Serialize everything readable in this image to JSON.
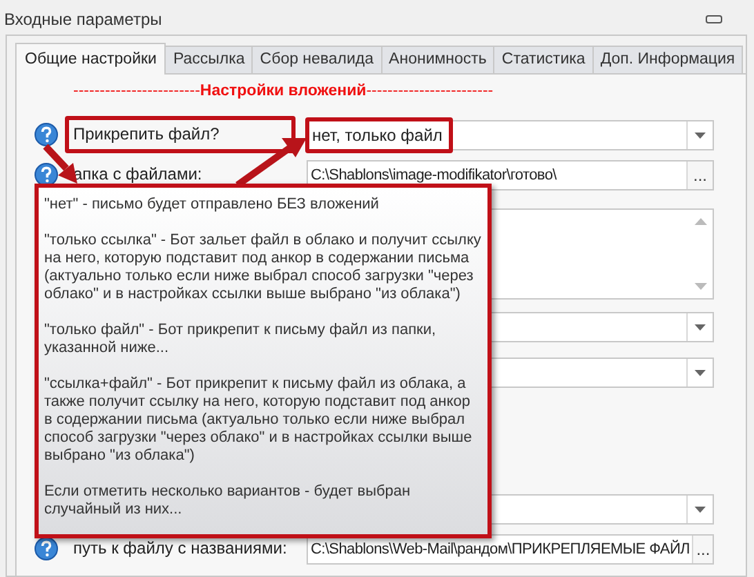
{
  "panel": {
    "title": "Входные параметры"
  },
  "tabs": [
    {
      "label": "Общие настройки",
      "selected": true
    },
    {
      "label": "Рассылка",
      "selected": false
    },
    {
      "label": "Сбор невалида",
      "selected": false
    },
    {
      "label": "Анонимность",
      "selected": false
    },
    {
      "label": "Статистика",
      "selected": false
    },
    {
      "label": "Доп. Информация",
      "selected": false
    }
  ],
  "section_heading": "------------------------**Настройки вложений**------------------------",
  "fields": [
    {
      "kind": "combo",
      "help": true,
      "label": "Прикрепить файл?",
      "value": "нет, только файл",
      "highlighted": true
    },
    {
      "kind": "path",
      "help": true,
      "label": "апка с файлами:",
      "value": "C:\\Shablons\\image-modifikator\\готово\\",
      "button": "..."
    },
    {
      "kind": "textarea"
    },
    {
      "kind": "combo"
    },
    {
      "kind": "combo"
    },
    {
      "kind": "combo"
    },
    {
      "kind": "path",
      "help": true,
      "label": "путь к файлу с названиями:",
      "value": "C:\\Shablons\\Web-Mail\\рандом\\ПРИКРЕПЛЯЕМЫЕ ФАЙЛ",
      "button": "..."
    }
  ],
  "tooltip": {
    "paragraphs": [
      "\"нет\" - письмо будет отправлено БЕЗ вложений",
      "\"только ссылка\" - Бот зальет файл в облако и получит ссылку на него, которую подставит под анкор в содержании письма (актуально только если ниже выбрал способ загрузки \"через облако\" и в настройках ссылки выше выбрано \"из облака\")",
      "\"только файл\" - Бот прикрепит к письму файл из папки, указанной ниже...",
      "\"ссылка+файл\" - Бот прикрепит к письму файл из облака, а также получит ссылку на него, которую подставит под анкор в содержании письма (актуально только если ниже выбрал способ загрузки \"через облако\" и в настройках ссылки выше выбрано \"из облака\")",
      "Если отметить несколько вариантов - будет выбран случайный из них..."
    ]
  }
}
